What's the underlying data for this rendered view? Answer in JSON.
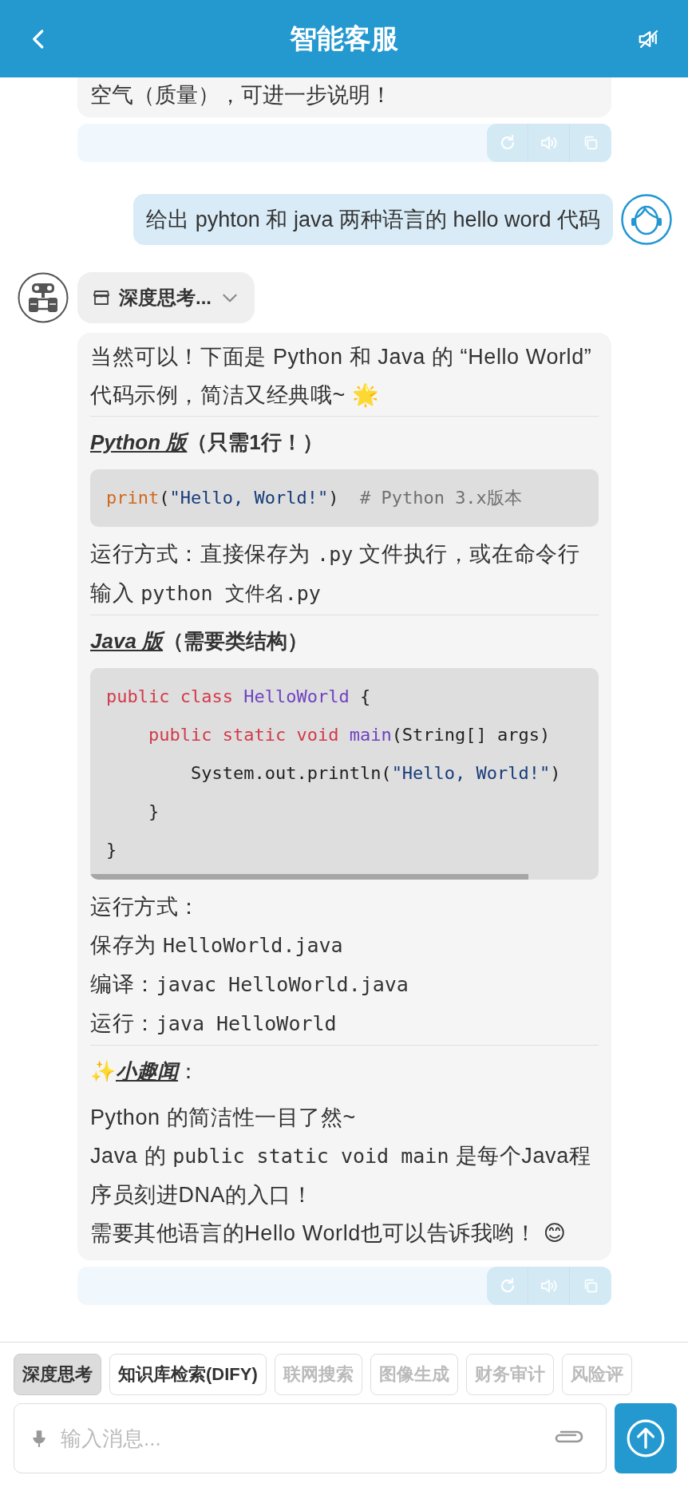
{
  "header": {
    "title": "智能客服"
  },
  "history": {
    "text": "空气（质量），可进一步说明！"
  },
  "user_message": {
    "text": "给出 pyhton 和 java 两种语言的 hello word 代码"
  },
  "bot_message": {
    "mode": "深度思考...",
    "blocks": [
      {
        "kind": "p",
        "segments": [
          {
            "text": "当然可以！下面是 Python 和 Java 的 “Hello World” 代码示例，简洁又经典哦~ 🌟",
            "code": false
          }
        ]
      },
      {
        "kind": "heading",
        "title": "Python 版",
        "note": "（只需1行！）"
      },
      {
        "kind": "code",
        "scrollable": false,
        "lines": [
          [
            {
              "color": "#d2691e",
              "text": "print"
            },
            {
              "color": "#222222",
              "text": "("
            },
            {
              "color": "#163b7a",
              "text": "\"Hello, World!\""
            },
            {
              "color": "#222222",
              "text": ")  "
            },
            {
              "color": "#707070",
              "text": "# Python 3.x版本"
            }
          ]
        ]
      },
      {
        "kind": "p",
        "segments": [
          {
            "text": "运行方式：直接保存为 ",
            "code": false
          },
          {
            "text": ".py",
            "code": true
          },
          {
            "text": " 文件执行，或在命令行输入 ",
            "code": false
          },
          {
            "text": "python 文件名.py",
            "code": true
          }
        ]
      },
      {
        "kind": "heading",
        "title": "Java 版",
        "note": "（需要类结构）"
      },
      {
        "kind": "code",
        "scrollable": true,
        "lines": [
          [
            {
              "color": "#d33a4a",
              "text": "public class "
            },
            {
              "color": "#6f42c1",
              "text": "HelloWorld"
            },
            {
              "color": "#222222",
              "text": " {"
            }
          ],
          [
            {
              "color": "#d33a4a",
              "text": "    public static void "
            },
            {
              "color": "#6f42c1",
              "text": "main"
            },
            {
              "color": "#222222",
              "text": "(String[] args)"
            }
          ],
          [
            {
              "color": "#222222",
              "text": "        System.out.println("
            },
            {
              "color": "#163b7a",
              "text": "\"Hello, World!\""
            },
            {
              "color": "#222222",
              "text": ")"
            }
          ],
          [
            {
              "color": "#222222",
              "text": "    }"
            }
          ],
          [
            {
              "color": "#222222",
              "text": "}"
            }
          ]
        ]
      },
      {
        "kind": "p",
        "segments": [
          {
            "text": "运行方式：",
            "code": false
          }
        ]
      },
      {
        "kind": "p",
        "segments": [
          {
            "text": "保存为 ",
            "code": false
          },
          {
            "text": "HelloWorld.java",
            "code": true
          }
        ]
      },
      {
        "kind": "p",
        "segments": [
          {
            "text": "编译：",
            "code": false
          },
          {
            "text": "javac HelloWorld.java",
            "code": true
          }
        ]
      },
      {
        "kind": "p",
        "segments": [
          {
            "text": "运行：",
            "code": false
          },
          {
            "text": "java HelloWorld",
            "code": true
          }
        ]
      },
      {
        "kind": "heading",
        "icon": "✨",
        "title": "小趣闻",
        "note": "："
      },
      {
        "kind": "p",
        "segments": [
          {
            "text": "Python 的简洁性一目了然~",
            "code": false
          }
        ]
      },
      {
        "kind": "p",
        "segments": [
          {
            "text": "Java 的 ",
            "code": false
          },
          {
            "text": "public static void main",
            "code": true
          },
          {
            "text": " 是每个Java程序员刻进DNA的入口！",
            "code": false
          }
        ]
      },
      {
        "kind": "p",
        "segments": [
          {
            "text": "需要其他语言的Hello World也可以告诉我哟！ 😊",
            "code": false
          }
        ]
      }
    ]
  },
  "chips": [
    {
      "label": "深度思考",
      "selected": true,
      "disabled": false
    },
    {
      "label": "知识库检索(DIFY)",
      "selected": false,
      "disabled": false
    },
    {
      "label": "联网搜索",
      "selected": false,
      "disabled": true
    },
    {
      "label": "图像生成",
      "selected": false,
      "disabled": true
    },
    {
      "label": "财务审计",
      "selected": false,
      "disabled": true
    },
    {
      "label": "风险评",
      "selected": false,
      "disabled": true
    }
  ],
  "input": {
    "placeholder": "输入消息..."
  }
}
